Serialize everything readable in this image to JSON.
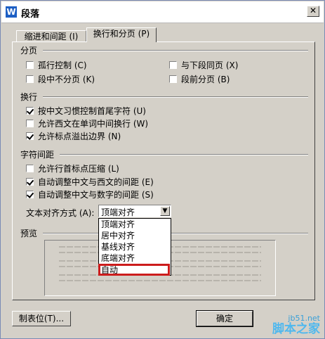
{
  "window": {
    "title": "段落",
    "close_glyph": "✕",
    "app_icon_glyph": "W"
  },
  "tabs": [
    {
      "label": "缩进和间距 (I)",
      "active": false
    },
    {
      "label": "换行和分页 (P)",
      "active": true
    }
  ],
  "pagination": {
    "heading": "分页",
    "items": [
      {
        "label": "孤行控制 (C)",
        "checked": false
      },
      {
        "label": "与下段同页 (X)",
        "checked": false
      },
      {
        "label": "段中不分页 (K)",
        "checked": false
      },
      {
        "label": "段前分页 (B)",
        "checked": false
      }
    ]
  },
  "linebreak": {
    "heading": "换行",
    "items": [
      {
        "label": "按中文习惯控制首尾字符 (U)",
        "checked": true
      },
      {
        "label": "允许西文在单词中间换行 (W)",
        "checked": false
      },
      {
        "label": "允许标点溢出边界 (N)",
        "checked": true
      }
    ]
  },
  "char_spacing": {
    "heading": "字符间距",
    "items": [
      {
        "label": "允许行首标点压缩 (L)",
        "checked": false
      },
      {
        "label": "自动调整中文与西文的间距 (E)",
        "checked": true
      },
      {
        "label": "自动调整中文与数字的间距 (S)",
        "checked": true
      }
    ],
    "align_label": "文本对齐方式 (A):",
    "align_value": "顶端对齐",
    "align_options": [
      "顶端对齐",
      "居中对齐",
      "基线对齐",
      "底端对齐",
      "自动"
    ]
  },
  "preview": {
    "heading": "预览"
  },
  "buttons": {
    "tabs": "制表位(T)...",
    "ok": "确定"
  },
  "watermark": {
    "url": "jb51.net",
    "name": "脚本之家"
  }
}
